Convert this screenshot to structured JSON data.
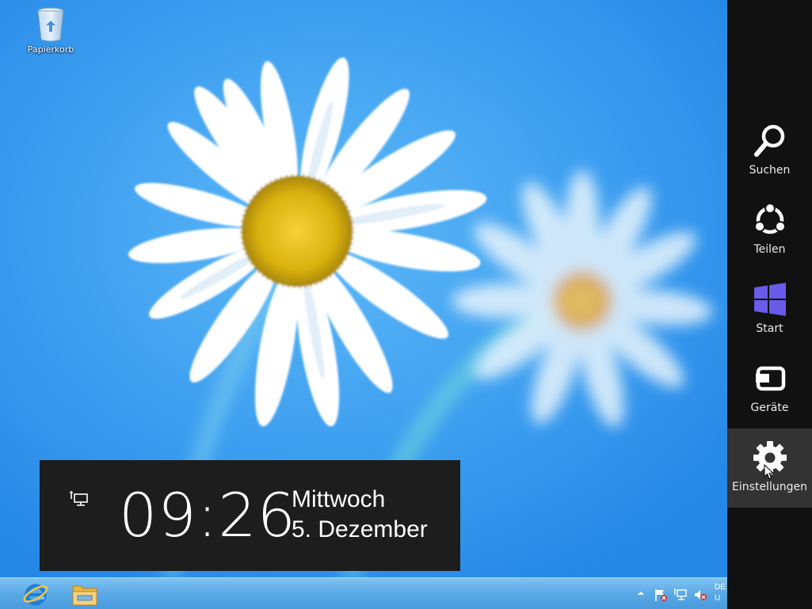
{
  "desktop": {
    "icons": [
      {
        "label": "Papierkorb",
        "icon": "recycle-bin-icon"
      }
    ]
  },
  "clock": {
    "time": "09:26",
    "day": "Mittwoch",
    "date": "5. Dezember",
    "icon": "network-icon"
  },
  "taskbar": {
    "pinned": [
      {
        "name": "Internet Explorer",
        "icon": "internet-explorer-icon"
      },
      {
        "name": "Explorer",
        "icon": "file-explorer-icon"
      }
    ],
    "tray": {
      "language": "DE",
      "language_line2": "U",
      "icons": [
        "show-hidden-icons-icon",
        "action-center-flag-icon",
        "network-icon",
        "volume-muted-icon"
      ]
    }
  },
  "charms": {
    "items": [
      {
        "label": "Suchen",
        "icon": "search-icon"
      },
      {
        "label": "Teilen",
        "icon": "share-icon"
      },
      {
        "label": "Start",
        "icon": "windows-logo-icon"
      },
      {
        "label": "Geräte",
        "icon": "devices-icon"
      },
      {
        "label": "Einstellungen",
        "icon": "gear-icon"
      }
    ],
    "active_index": 4
  },
  "colors": {
    "charms_bg": "#111111",
    "charm_active_bg": "#333333",
    "windows_accent": "#6a5be8",
    "clock_panel_bg": "#1d1d1d"
  }
}
